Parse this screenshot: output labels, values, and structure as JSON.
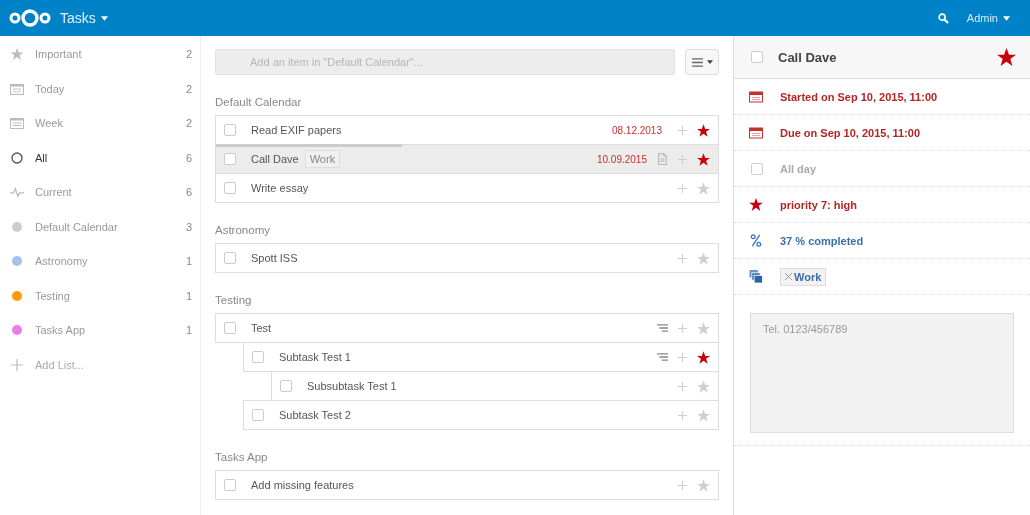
{
  "header": {
    "app_name": "Tasks",
    "user": "Admin"
  },
  "sidebar": {
    "items": [
      {
        "kind": "important",
        "label": "Important",
        "count": "2",
        "selected": false
      },
      {
        "kind": "today",
        "label": "Today",
        "count": "2",
        "selected": false
      },
      {
        "kind": "week",
        "label": "Week",
        "count": "2",
        "selected": false
      },
      {
        "kind": "all",
        "label": "All",
        "count": "6",
        "selected": true
      },
      {
        "kind": "current",
        "label": "Current",
        "count": "6",
        "selected": false
      },
      {
        "kind": "list",
        "label": "Default Calendar",
        "count": "3",
        "selected": false,
        "color": "#cccccc"
      },
      {
        "kind": "list",
        "label": "Astronomy",
        "count": "1",
        "selected": false,
        "color": "#a1c5e8"
      },
      {
        "kind": "list",
        "label": "Testing",
        "count": "1",
        "selected": false,
        "color": "#ff9c00"
      },
      {
        "kind": "list",
        "label": "Tasks App",
        "count": "1",
        "selected": false,
        "color": "#e87ee8"
      }
    ],
    "add_list": "Add List..."
  },
  "add_task": {
    "placeholder": "Add an item in \"Default Calendar\"..."
  },
  "lists": [
    {
      "name": "Default Calendar",
      "tasks": [
        {
          "title": "Read EXIF papers",
          "checked": false,
          "selected": false,
          "date": "08.12.2013",
          "starred": true
        },
        {
          "title": "Call Dave",
          "checked": false,
          "selected": true,
          "tag": "Work",
          "date": "10.09.2015",
          "has_note": true,
          "starred": true,
          "level": 0.37
        },
        {
          "title": "Write essay",
          "checked": false,
          "selected": false,
          "starred": false
        }
      ]
    },
    {
      "name": "Astronomy",
      "tasks": [
        {
          "title": "Spott ISS",
          "checked": false,
          "selected": false,
          "starred": false
        }
      ]
    },
    {
      "name": "Testing",
      "tasks": [
        {
          "title": "Test",
          "checked": false,
          "selected": false,
          "starred": false,
          "children": [
            {
              "title": "Subtask Test 1",
              "checked": false,
              "selected": false,
              "starred": true,
              "children": [
                {
                  "title": "Subsubtask Test 1",
                  "checked": false,
                  "selected": false,
                  "starred": false
                }
              ]
            },
            {
              "title": "Subtask Test 2",
              "checked": false,
              "selected": false,
              "starred": false
            }
          ]
        }
      ]
    },
    {
      "name": "Tasks App",
      "tasks": [
        {
          "title": "Add missing features",
          "checked": false,
          "selected": false,
          "starred": false
        }
      ]
    }
  ],
  "details": {
    "title": "Call Dave",
    "checked": false,
    "starred": true,
    "rows": [
      {
        "kind": "start",
        "text": "Started on Sep 10, 2015, 11:00"
      },
      {
        "kind": "due",
        "text": "Due on Sep 10, 2015, 11:00"
      },
      {
        "kind": "allday",
        "text": "All day",
        "checked": false
      },
      {
        "kind": "priority",
        "text": "priority 7: high"
      },
      {
        "kind": "percent",
        "text": "37 % completed"
      },
      {
        "kind": "categories",
        "tags": [
          "Work"
        ]
      }
    ],
    "note": "Tel. 0123/456789"
  }
}
